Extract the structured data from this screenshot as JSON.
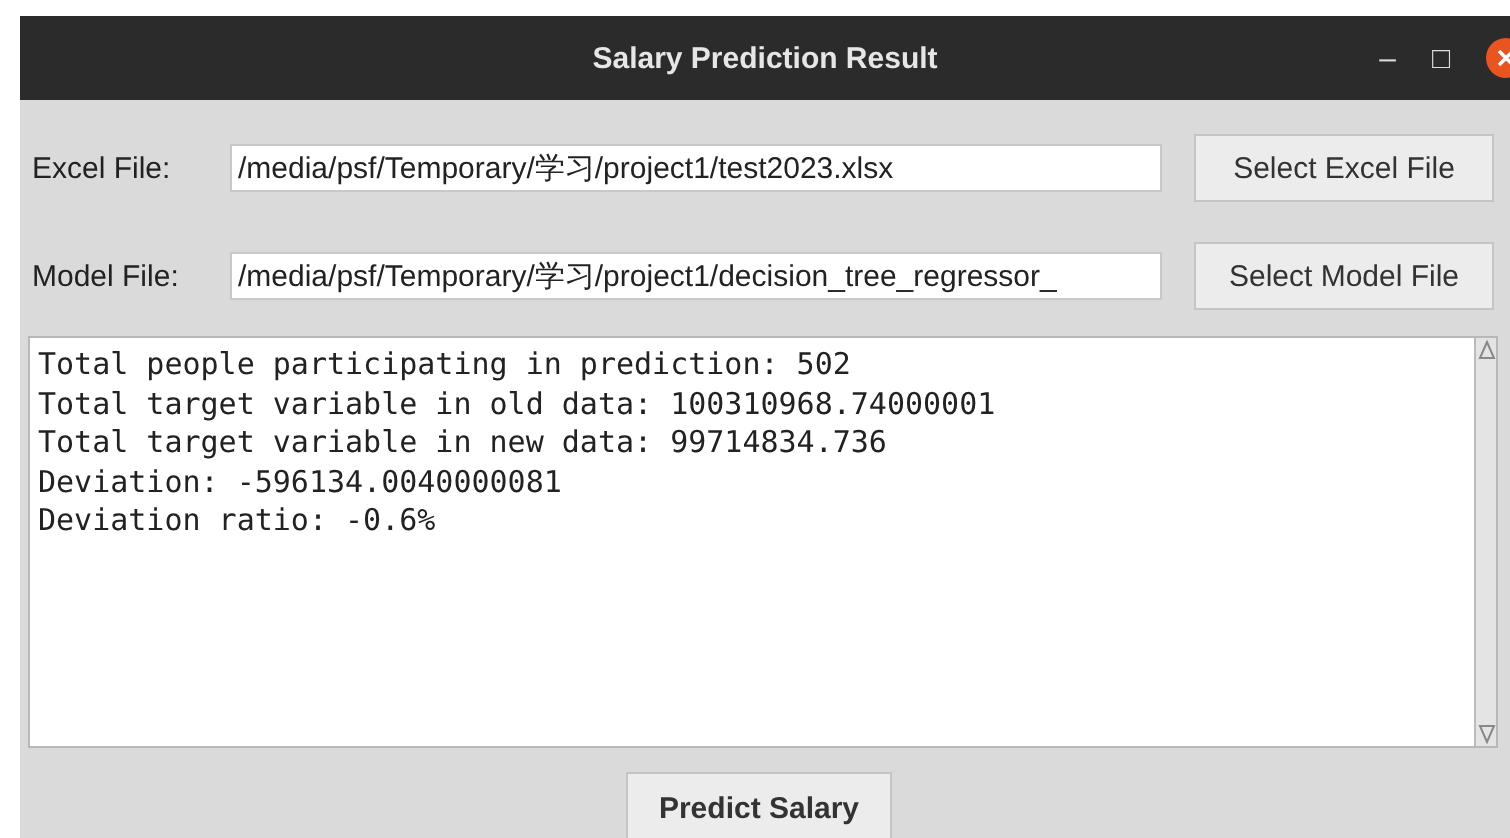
{
  "window": {
    "title": "Salary Prediction Result",
    "controls": [
      "–",
      "□"
    ]
  },
  "file_rows": [
    {
      "label": "Excel File:",
      "value": "/media/psf/Temporary/学习/project1/test2023.xlsx",
      "button": "Select Excel File"
    },
    {
      "label": "Model File:",
      "value": "/media/psf/Temporary/学习/project1/decision_tree_regressor_",
      "button": "Select Model File"
    }
  ],
  "output_lines": [
    "Total people participating in prediction: 502",
    "Total target variable in old data: 100310968.74000001",
    "Total target variable in new data: 99714834.736",
    "Deviation: -596134.0040000081",
    "Deviation ratio: -0.6%"
  ],
  "action_button": "Predict Salary"
}
